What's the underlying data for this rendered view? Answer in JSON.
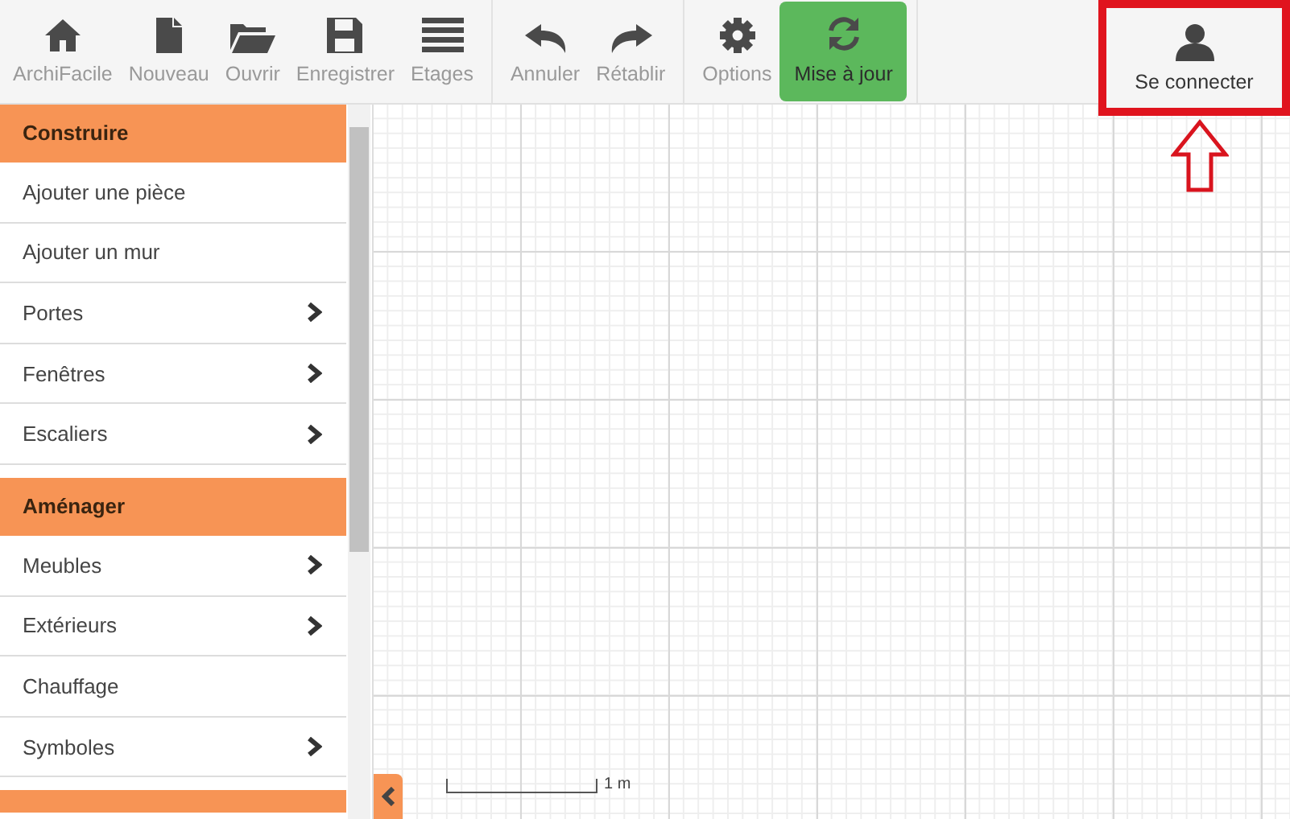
{
  "toolbar": {
    "groups": [
      [
        {
          "label": "ArchiFacile",
          "kind": "home",
          "highlighted": false
        },
        {
          "label": "Nouveau",
          "kind": "file",
          "highlighted": false
        },
        {
          "label": "Ouvrir",
          "kind": "folder",
          "highlighted": false
        },
        {
          "label": "Enregistrer",
          "kind": "save",
          "highlighted": false
        },
        {
          "label": "Etages",
          "kind": "bars",
          "highlighted": false
        }
      ],
      [
        {
          "label": "Annuler",
          "kind": "undo",
          "highlighted": false
        },
        {
          "label": "Rétablir",
          "kind": "redo",
          "highlighted": false
        }
      ],
      [
        {
          "label": "Options",
          "kind": "gear",
          "highlighted": false
        },
        {
          "label": "Mise à jour",
          "kind": "refresh",
          "highlighted": true
        }
      ]
    ],
    "login": {
      "label": "Se connecter",
      "annotated": true
    }
  },
  "sidebar": {
    "sections": [
      {
        "title": "Construire",
        "items": [
          {
            "label": "Ajouter une pièce",
            "submenu": false
          },
          {
            "label": "Ajouter un mur",
            "submenu": false
          },
          {
            "label": "Portes",
            "submenu": true
          },
          {
            "label": "Fenêtres",
            "submenu": true
          },
          {
            "label": "Escaliers",
            "submenu": true
          }
        ]
      },
      {
        "title": "Aménager",
        "items": [
          {
            "label": "Meubles",
            "submenu": true
          },
          {
            "label": "Extérieurs",
            "submenu": true
          },
          {
            "label": "Chauffage",
            "submenu": false
          },
          {
            "label": "Symboles",
            "submenu": true
          }
        ]
      }
    ]
  },
  "canvas": {
    "scale_label": "1 m"
  }
}
